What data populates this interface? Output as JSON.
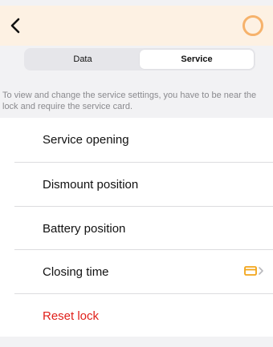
{
  "header": {
    "back_icon": "chevron-left-icon",
    "status_icon": "ring-icon",
    "accent_color": "#f6b26b"
  },
  "tabs": [
    {
      "label": "Data",
      "active": false
    },
    {
      "label": "Service",
      "active": true
    }
  ],
  "info_text": "To view and change the service settings, you have to be near the lock and require the service card.",
  "menu": {
    "service_opening": "Service opening",
    "dismount_position": "Dismount position",
    "battery_position": "Battery position",
    "closing_time": "Closing time",
    "closing_time_accessory": "card-icon",
    "reset_lock": "Reset lock",
    "reset_color": "#e0201a"
  }
}
